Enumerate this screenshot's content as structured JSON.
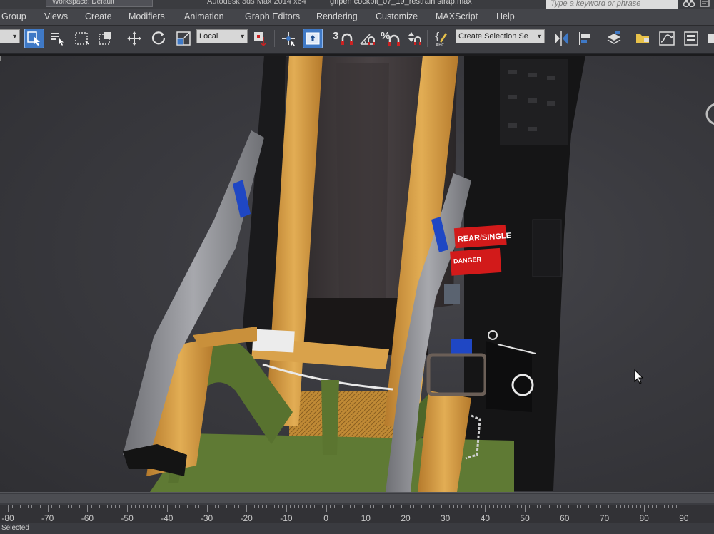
{
  "window": {
    "workspace_tab": "Workspace: Default",
    "app_title": "Autodesk 3ds Max  2014 x64",
    "file_title": "gripen cockpit_07_19_restrain strap.max",
    "search_placeholder": "Type a keyword or phrase",
    "binoculars_icon": "binoculars-icon",
    "help_icon": "help-icon"
  },
  "menu": {
    "items": [
      "Group",
      "Views",
      "Create",
      "Modifiers",
      "Animation",
      "Graph Editors",
      "Rendering",
      "Customize",
      "MAXScript",
      "Help"
    ]
  },
  "toolbar": {
    "filter_value": "",
    "coord_system": "Local",
    "snap_numbers": [
      "3",
      "%"
    ],
    "selection_set_value": "Create Selection Se",
    "icons": [
      "select-object-icon",
      "select-by-name-icon",
      "rect-selection-icon",
      "window-crossing-icon",
      "move-icon",
      "rotate-icon",
      "scale-icon",
      "use-pivot-center-icon",
      "select-manipulate-icon",
      "keyboard-shortcut-icon",
      "snaps-toggle-icon",
      "angle-snap-icon",
      "percent-snap-icon",
      "spinner-snap-icon",
      "edit-named-selection-icon",
      "mirror-icon",
      "align-icon",
      "layer-manager-icon",
      "scene-explorer-icon",
      "curve-editor-icon",
      "schematic-view-icon"
    ]
  },
  "viewport": {
    "decal_line1": "REAR/SINGLE",
    "decal_line2": "DANGER"
  },
  "timeline": {
    "ticks": [
      "-80",
      "-70",
      "-60",
      "-50",
      "-40",
      "-30",
      "-20",
      "-10",
      "0",
      "10",
      "20",
      "30",
      "40",
      "50",
      "60",
      "70",
      "80",
      "90"
    ],
    "status": "Selected"
  },
  "colors": {
    "accent": "#3f79c6",
    "strap_orange": "#d39a3e",
    "webbing_grey": "#8f9095",
    "cushion_green": "#5f7a34",
    "decal_red": "#d21a1a"
  }
}
